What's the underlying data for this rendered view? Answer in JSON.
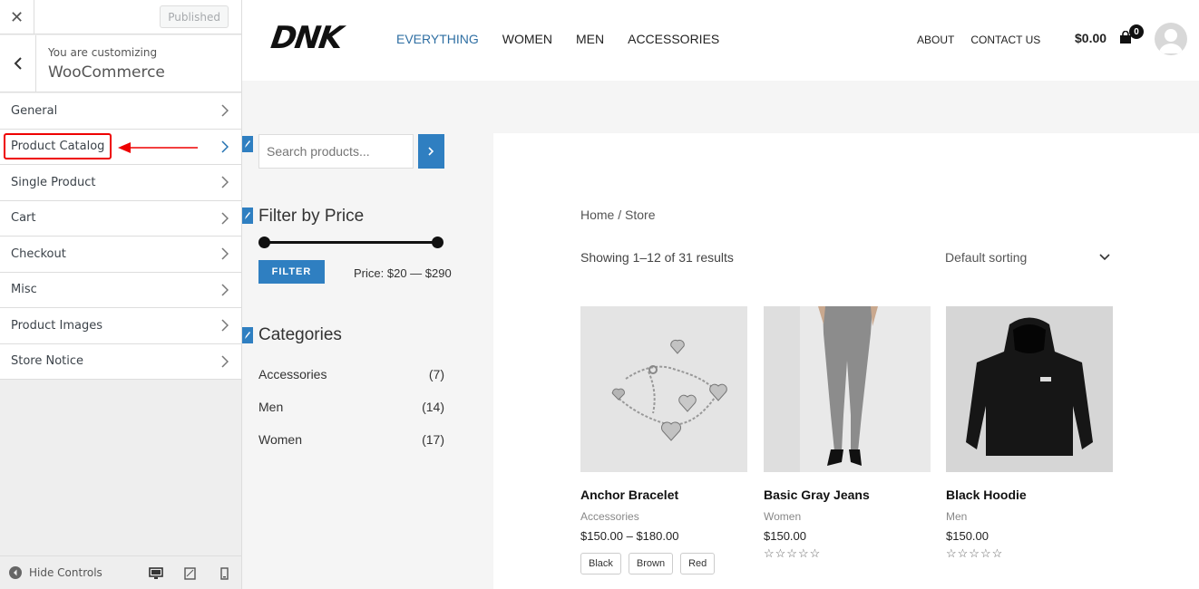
{
  "customizer": {
    "published_label": "Published",
    "sub_label": "You are customizing",
    "title": "WooCommerce",
    "items": [
      {
        "label": "General"
      },
      {
        "label": "Product Catalog"
      },
      {
        "label": "Single Product"
      },
      {
        "label": "Cart"
      },
      {
        "label": "Checkout"
      },
      {
        "label": "Misc"
      },
      {
        "label": "Product Images"
      },
      {
        "label": "Store Notice"
      }
    ],
    "hide_controls": "Hide Controls",
    "highlight_color": "#e00000"
  },
  "site": {
    "logo": "DNK",
    "nav_main": [
      "EVERYTHING",
      "WOMEN",
      "MEN",
      "ACCESSORIES"
    ],
    "nav_secondary": [
      "ABOUT",
      "CONTACT US"
    ],
    "cart_total": "$0.00",
    "cart_count": "0",
    "accent_color": "#2f7fc1"
  },
  "sidebar": {
    "search_placeholder": "Search products...",
    "filter_title": "Filter by Price",
    "filter_button": "FILTER",
    "price_label": "Price:",
    "price_range": "$20 — $290",
    "categories_title": "Categories",
    "categories": [
      {
        "name": "Accessories",
        "count": "(7)"
      },
      {
        "name": "Men",
        "count": "(14)"
      },
      {
        "name": "Women",
        "count": "(17)"
      }
    ]
  },
  "shop": {
    "breadcrumb_home": "Home",
    "breadcrumb_sep": "/",
    "breadcrumb_current": "Store",
    "result_count": "Showing 1–12 of 31 results",
    "sorting": "Default sorting",
    "products": [
      {
        "name": "Anchor Bracelet",
        "category": "Accessories",
        "price": "$150.00 – $180.00",
        "swatches": [
          "Black",
          "Brown",
          "Red"
        ]
      },
      {
        "name": "Basic Gray Jeans",
        "category": "Women",
        "price": "$150.00",
        "stars": "☆☆☆☆☆"
      },
      {
        "name": "Black Hoodie",
        "category": "Men",
        "price": "$150.00",
        "stars": "☆☆☆☆☆"
      }
    ]
  }
}
